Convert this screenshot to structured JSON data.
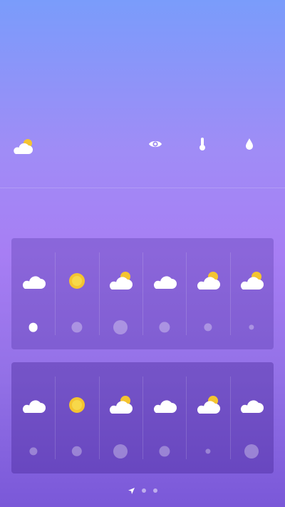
{
  "colors": {
    "sun": "#f4c430",
    "sun_core": "#f7d84a",
    "cloud": "#ffffff"
  },
  "summary": {
    "current_icon": "partly-cloudy-icon",
    "stats": [
      {
        "icon": "eye-icon"
      },
      {
        "icon": "thermometer-icon"
      },
      {
        "icon": "droplet-icon"
      }
    ]
  },
  "panels": [
    {
      "columns": [
        {
          "icon": "cloud-icon",
          "dot_level": 0.55,
          "dot_active": true
        },
        {
          "icon": "sun-icon",
          "dot_level": 0.7,
          "dot_active": false
        },
        {
          "icon": "partly-cloudy-icon",
          "dot_level": 1.0,
          "dot_active": false
        },
        {
          "icon": "cloud-icon",
          "dot_level": 0.7,
          "dot_active": false
        },
        {
          "icon": "partly-cloudy-icon",
          "dot_level": 0.45,
          "dot_active": false
        },
        {
          "icon": "partly-cloudy-icon",
          "dot_level": 0.2,
          "dot_active": false
        }
      ]
    },
    {
      "columns": [
        {
          "icon": "cloud-icon",
          "dot_level": 0.45,
          "dot_active": false
        },
        {
          "icon": "sun-icon",
          "dot_level": 0.65,
          "dot_active": false
        },
        {
          "icon": "partly-cloudy-icon",
          "dot_level": 1.0,
          "dot_active": false
        },
        {
          "icon": "cloud-icon",
          "dot_level": 0.7,
          "dot_active": false
        },
        {
          "icon": "partly-cloudy-icon",
          "dot_level": 0.2,
          "dot_active": false
        },
        {
          "icon": "cloud-icon",
          "dot_level": 1.0,
          "dot_active": false
        }
      ]
    }
  ],
  "pager": {
    "pages": 3,
    "current": 0,
    "first_icon": "location-arrow-icon"
  }
}
